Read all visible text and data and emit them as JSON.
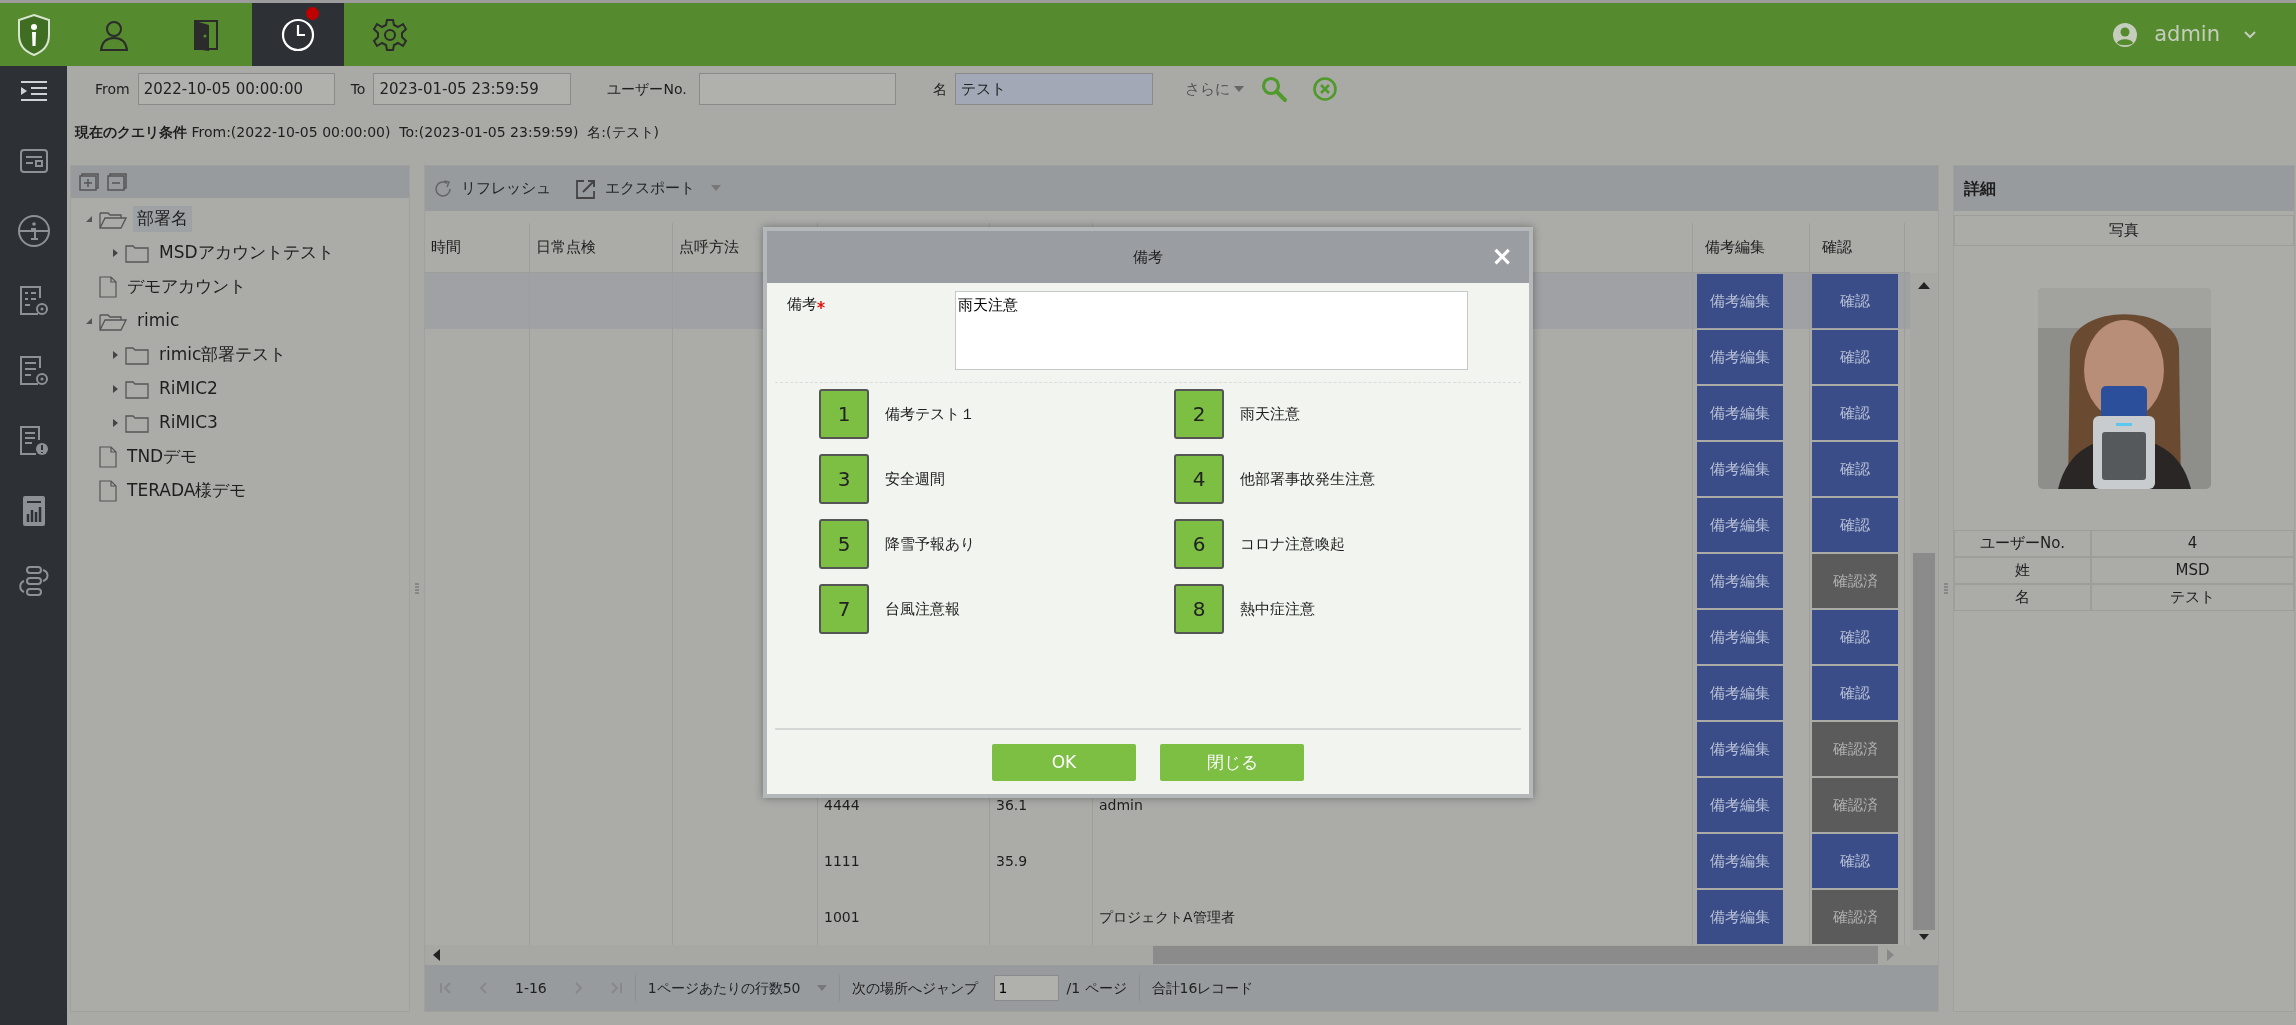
{
  "top_nav": {
    "items": [
      {
        "selected": false,
        "badge": false
      },
      {
        "selected": false,
        "badge": false
      },
      {
        "selected": true,
        "badge": true
      },
      {
        "selected": false,
        "badge": false
      }
    ],
    "user": "admin"
  },
  "filter": {
    "from_label": "From",
    "from_value": "2022-10-05 00:00:00",
    "to_label": "To",
    "to_value": "2023-01-05 23:59:59",
    "user_no_label": "ユーザーNo.",
    "name_label": "名",
    "name_value": "テスト",
    "more_label": "さらに"
  },
  "query_condition": "**現在のクエリ条件** From:(2022-10-05 00:00:00)  To:(2023-01-05 23:59:59)  名:(テスト)",
  "tree": {
    "items": [
      {
        "kind": "folder",
        "label": "部署名",
        "expanded": true,
        "selected": true,
        "children": [
          {
            "kind": "folder",
            "label": "MSDアカウントテスト",
            "expanded": false,
            "selected": false
          }
        ]
      },
      {
        "kind": "file",
        "label": "デモアカウント",
        "selected": false
      },
      {
        "kind": "folder",
        "label": "rimic",
        "expanded": true,
        "selected": false,
        "children": [
          {
            "kind": "folder",
            "label": "rimic部署テスト",
            "expanded": false,
            "selected": false
          },
          {
            "kind": "folder",
            "label": "RiMIC2",
            "expanded": false,
            "selected": false
          },
          {
            "kind": "folder",
            "label": "RiMIC3",
            "expanded": false,
            "selected": false
          }
        ]
      },
      {
        "kind": "file",
        "label": "TNDデモ",
        "selected": false
      },
      {
        "kind": "file",
        "label": "TERADA様デモ",
        "selected": false
      }
    ]
  },
  "table": {
    "toolbar": {
      "refresh": "リフレッシュ",
      "export": "エクスポート"
    },
    "columns": [
      "時間",
      "日常点検",
      "点呼方法"
    ],
    "action_columns": [
      "備考編集",
      "確認"
    ],
    "rows": [
      {
        "selected": true,
        "edit": "備考編集",
        "confirm": "確認",
        "confirmed": false
      },
      {
        "selected": false,
        "edit": "備考編集",
        "confirm": "確認",
        "confirmed": false
      },
      {
        "selected": false,
        "edit": "備考編集",
        "confirm": "確認",
        "confirmed": false
      },
      {
        "selected": false,
        "edit": "備考編集",
        "confirm": "確認",
        "confirmed": false
      },
      {
        "selected": false,
        "edit": "備考編集",
        "confirm": "確認",
        "confirmed": false
      },
      {
        "selected": false,
        "edit": "備考編集",
        "confirm": "確認済",
        "confirmed": true
      },
      {
        "selected": false,
        "edit": "備考編集",
        "confirm": "確認",
        "confirmed": false
      },
      {
        "selected": false,
        "edit": "備考編集",
        "confirm": "確認",
        "confirmed": false
      },
      {
        "selected": false,
        "edit": "備考編集",
        "confirm": "確認済",
        "confirmed": true
      },
      {
        "selected": false,
        "column_4": "4444",
        "column_5": "36.1",
        "column_6": "admin",
        "edit": "備考編集",
        "confirm": "確認済",
        "confirmed": true
      },
      {
        "selected": false,
        "column_4": "1111",
        "column_5": "35.9",
        "edit": "備考編集",
        "confirm": "確認",
        "confirmed": false
      },
      {
        "selected": false,
        "column_4": "1001",
        "column_6": "プロジェクトA管理者",
        "edit": "備考編集",
        "confirm": "確認済",
        "confirmed": true
      }
    ]
  },
  "pager": {
    "range": "1-16",
    "rows_per_page": "1ページあたりの行数50",
    "jump_label": "次の場所へジャンプ",
    "page_value": "1",
    "page_total": "/1 ページ",
    "total": "合計16レコード"
  },
  "detail": {
    "title": "詳細",
    "photo_label": "写真",
    "fields": [
      {
        "label": "ユーザーNo.",
        "value": "4"
      },
      {
        "label": "姓",
        "value": "MSD"
      },
      {
        "label": "名",
        "value": "テスト"
      }
    ]
  },
  "dialog": {
    "title": "備考",
    "close": "×",
    "field_label": "備考",
    "required": true,
    "value": "雨天注意",
    "phrases": [
      {
        "number": "1",
        "label": "備考テスト１"
      },
      {
        "number": "2",
        "label": "雨天注意"
      },
      {
        "number": "3",
        "label": "安全週間"
      },
      {
        "number": "4",
        "label": "他部署事故発生注意"
      },
      {
        "number": "5",
        "label": "降雪予報あり"
      },
      {
        "number": "6",
        "label": "コロナ注意喚起"
      },
      {
        "number": "7",
        "label": "台風注意報"
      },
      {
        "number": "8",
        "label": "熱中症注意"
      }
    ],
    "buttons": [
      "OK",
      "閉じる"
    ]
  }
}
